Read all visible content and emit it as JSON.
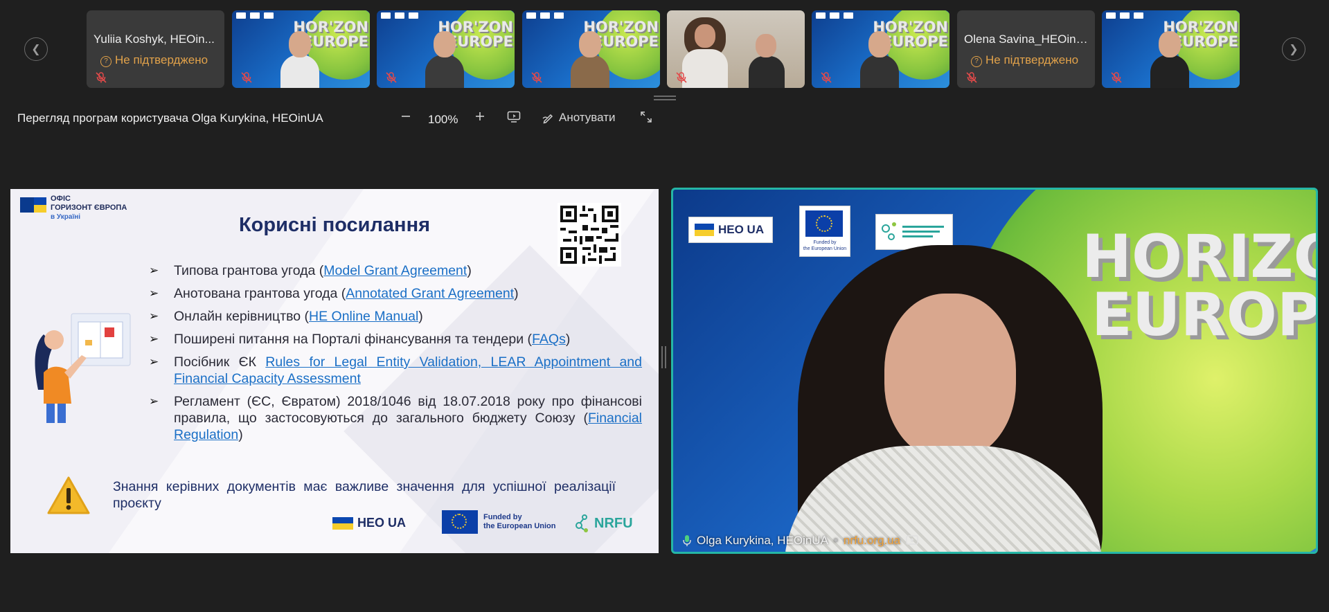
{
  "participants": [
    {
      "type": "name",
      "name": "Yuliia Koshyk, HEOin...",
      "status": "Не підтверджено"
    },
    {
      "type": "video"
    },
    {
      "type": "video"
    },
    {
      "type": "video"
    },
    {
      "type": "room"
    },
    {
      "type": "video"
    },
    {
      "type": "name",
      "name": "Olena Savina_HEOinUA",
      "status": "Не підтверджено"
    },
    {
      "type": "video"
    }
  ],
  "toolbar": {
    "viewing_title": "Перегляд програм користувача Olga Kurykina, HEOinUA",
    "zoom": "100%",
    "annotate_label": "Анотувати"
  },
  "slide": {
    "office_logo": {
      "line1": "ОФІС",
      "line2": "ГОРИЗОНТ ЄВРОПА",
      "line3": "в Україні"
    },
    "title": "Корисні посилання",
    "bullets": [
      {
        "pre": "Типова грантова угода (",
        "link": "Model Grant Agreement",
        "post": ")"
      },
      {
        "pre": "Анотована грантова угода (",
        "link": "Annotated Grant Agreement",
        "post": ")"
      },
      {
        "pre": "Онлайн керівництво (",
        "link": "HE Online Manual",
        "post": ")"
      },
      {
        "pre": "Поширені питання на Порталі фінансування та тендери (",
        "link": "FAQs",
        "post": ")"
      },
      {
        "pre": "Посібник ЄК ",
        "link": "Rules for Legal Entity Validation, LEAR Appointment and Financial Capacity Assessment",
        "post": ""
      },
      {
        "pre": "Регламент (ЄС, Євратом) 2018/1046 від 18.07.2018 року про фінансові правила, що застосовуються до загального бюджету Союзу (",
        "link": "Financial Regulation",
        "post": ")"
      }
    ],
    "warning_text": "Знання керівних документів має важливе значення для успішної реалізації проєкту",
    "footer": {
      "heo": "HEO UA",
      "eu_line1": "Funded by",
      "eu_line2": "the European Union",
      "nrfu": "NRFU"
    }
  },
  "speaker": {
    "name": "Olga Kurykina, HEOinUA",
    "org": "nrfu.org.ua",
    "overlay": {
      "horizon": "HORIZON",
      "europe": "EUROPE",
      "heo": "HEO UA",
      "eu_line1": "Funded by",
      "eu_line2": "the European Union"
    }
  },
  "colors": {
    "accent": "#25b6a6",
    "status": "#e2a24a",
    "link": "#1a6fc6",
    "title": "#1e2e66"
  }
}
